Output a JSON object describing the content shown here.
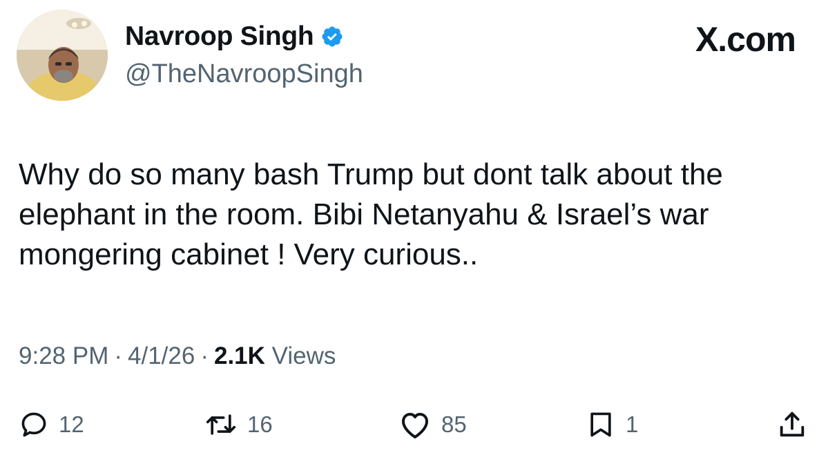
{
  "header": {
    "display_name": "Navroop Singh",
    "handle": "@TheNavroopSingh",
    "brand": "X.com",
    "verified_icon": "verified-badge-icon",
    "verified_color": "#1d9bf0"
  },
  "tweet": {
    "text": "Why do so many bash Trump but dont talk about the elephant in the room. Bibi Netanyahu & Israel’s war mongering cabinet ! Very curious.."
  },
  "meta": {
    "time": "9:28 PM",
    "separator": "·",
    "date": "4/1/26",
    "views_count": "2.1K",
    "views_label": "Views"
  },
  "actions": {
    "replies": "12",
    "reposts": "16",
    "likes": "85",
    "bookmarks": "1"
  },
  "colors": {
    "text_primary": "#0f1419",
    "text_secondary": "#536471"
  }
}
